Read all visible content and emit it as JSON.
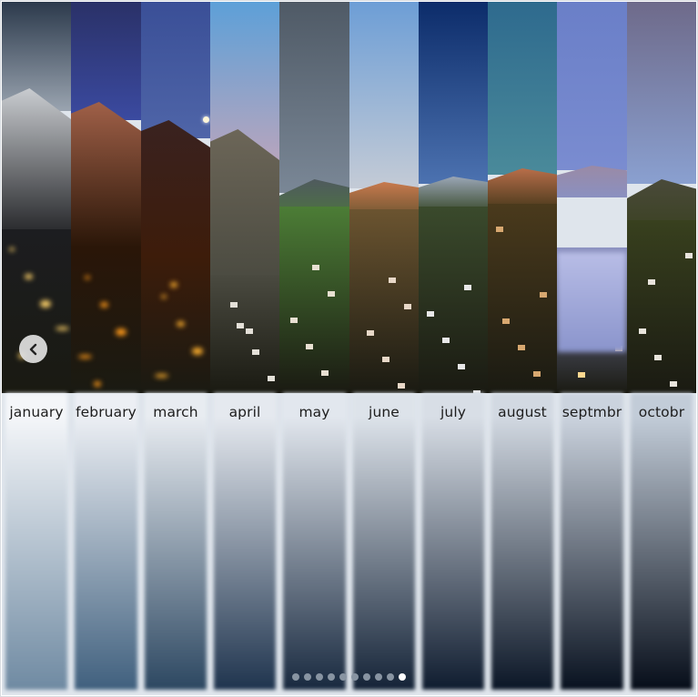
{
  "slideshow": {
    "months": [
      {
        "label": "january",
        "sky_top": "#2c3a4c",
        "sky_bottom": "#9aa4b0",
        "mountain": "#c9ccd0",
        "land": "#1c1d20",
        "grad_top": "#f4f6f9",
        "grad_bottom": "#6f8aa2",
        "lights": "#ffd36a"
      },
      {
        "label": "february",
        "sky_top": "#2a3168",
        "sky_bottom": "#3b4aa0",
        "mountain": "#a06048",
        "land": "#2a1608",
        "grad_top": "#eceff4",
        "grad_bottom": "#40607e",
        "lights": "#ff9a1a"
      },
      {
        "label": "march",
        "sky_top": "#3a4f97",
        "sky_bottom": "#4f65a8",
        "mountain": "#3a2220",
        "land": "#3d1c0a",
        "grad_top": "#e8ecf1",
        "grad_bottom": "#2c4761",
        "lights": "#ffb02e"
      },
      {
        "label": "april",
        "sky_top": "#5da0d8",
        "sky_bottom": "#c9a6b8",
        "mountain": "#6c6658",
        "land": "#4a4a40",
        "grad_top": "#e5e9ef",
        "grad_bottom": "#1f344e",
        "lights": "#e4e0d8"
      },
      {
        "label": "may",
        "sky_top": "#4f5a66",
        "sky_bottom": "#7a8796",
        "mountain": "#4f5a5e",
        "land": "#4c7d36",
        "grad_top": "#e2e7ee",
        "grad_bottom": "#18293f",
        "lights": "#e8e0d2"
      },
      {
        "label": "june",
        "sky_top": "#6d9ed6",
        "sky_bottom": "#c4cbd6",
        "mountain": "#c87a4e",
        "land": "#6b5430",
        "grad_top": "#dde3ea",
        "grad_bottom": "#142337",
        "lights": "#e8d8c8"
      },
      {
        "label": "july",
        "sky_top": "#0c2c6a",
        "sky_bottom": "#4c72b0",
        "mountain": "#9aa6b6",
        "land": "#3a4a2c",
        "grad_top": "#d8dee6",
        "grad_bottom": "#0f1c2f",
        "lights": "#e8e8e8"
      },
      {
        "label": "august",
        "sky_top": "#2e6a8e",
        "sky_bottom": "#4a8a9a",
        "mountain": "#b86e4a",
        "land": "#4a3a1c",
        "grad_top": "#d2d9e2",
        "grad_bottom": "#0b1626",
        "lights": "#d8a870"
      },
      {
        "label": "septmbr",
        "sky_top": "#6a7fc8",
        "sky_bottom": "#7a8cd0",
        "mountain": "#9a8aa6",
        "land": "#8a90c0",
        "grad_top": "#cbd3de",
        "grad_bottom": "#08111f",
        "lights": "#ffd890"
      },
      {
        "label": "octobr",
        "sky_top": "#6e6a8a",
        "sky_bottom": "#8aa0d0",
        "mountain": "#4a4a3a",
        "land": "#38401e",
        "grad_top": "#c2ccd8",
        "grad_bottom": "#060d19",
        "lights": "#e8e4dc"
      }
    ],
    "prev_button": {
      "icon": "chevron-left-icon"
    },
    "pagination": {
      "total": 10,
      "active_index": 9
    }
  }
}
